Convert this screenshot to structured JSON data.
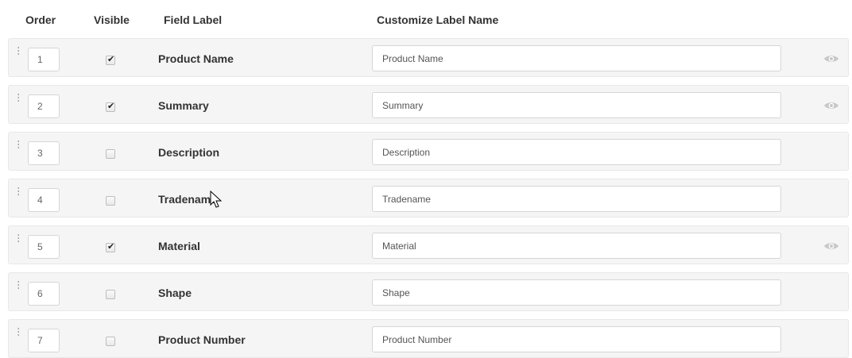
{
  "header": {
    "order": "Order",
    "visible": "Visible",
    "field_label": "Field Label",
    "customize": "Customize Label Name"
  },
  "rows": [
    {
      "order": "1",
      "visible": true,
      "label": "Product Name",
      "custom": "Product Name",
      "eye": true
    },
    {
      "order": "2",
      "visible": true,
      "label": "Summary",
      "custom": "Summary",
      "eye": true
    },
    {
      "order": "3",
      "visible": false,
      "label": "Description",
      "custom": "Description",
      "eye": false
    },
    {
      "order": "4",
      "visible": false,
      "label": "Tradename",
      "custom": "Tradename",
      "eye": false
    },
    {
      "order": "5",
      "visible": true,
      "label": "Material",
      "custom": "Material",
      "eye": true
    },
    {
      "order": "6",
      "visible": false,
      "label": "Shape",
      "custom": "Shape",
      "eye": false
    },
    {
      "order": "7",
      "visible": false,
      "label": "Product Number",
      "custom": "Product Number",
      "eye": false
    }
  ],
  "icons": {
    "drag": "drag-handle-icon",
    "check": "checkmark-icon",
    "eye": "eye-icon",
    "cursor": "pointer-cursor-icon"
  },
  "colors": {
    "row_bg": "#f5f5f5",
    "row_border": "#e8e8e8",
    "eye": "#c8c8c8"
  }
}
